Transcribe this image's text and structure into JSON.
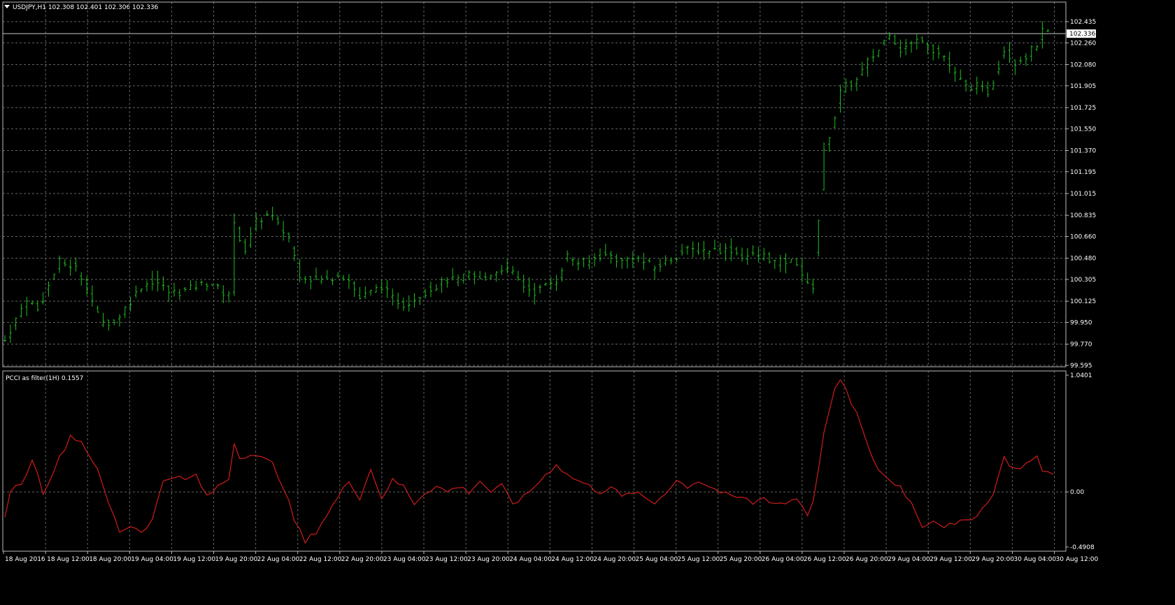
{
  "window": {
    "symbol_line": "USDJPY,H1  102.308 102.401 102.306 102.336",
    "indicator_line": "PCCI as filter(1H) 0.1557"
  },
  "colors": {
    "background": "#000000",
    "grid": "#5f6368",
    "price_bars": "#1fbf1f",
    "indicator_line": "#d01c1c",
    "text": "#ffffff"
  },
  "chart_data": [
    {
      "type": "ohlc",
      "title": "USDJPY,H1",
      "y_ticks": [
        "102.435",
        "102.260",
        "102.080",
        "101.905",
        "101.725",
        "101.550",
        "101.370",
        "101.195",
        "101.015",
        "100.835",
        "100.660",
        "100.480",
        "100.305",
        "100.125",
        "99.950",
        "99.770",
        "99.595"
      ],
      "ylim": [
        99.595,
        102.435
      ],
      "current_price": "102.336",
      "close_path": [
        [
          0,
          99.8
        ],
        [
          8,
          100.15
        ],
        [
          12,
          100.05
        ],
        [
          15,
          100.2
        ],
        [
          20,
          100.45
        ],
        [
          26,
          100.4
        ],
        [
          30,
          100.25
        ],
        [
          35,
          99.95
        ],
        [
          40,
          99.95
        ],
        [
          45,
          100.1
        ],
        [
          50,
          100.25
        ],
        [
          55,
          100.3
        ],
        [
          60,
          100.2
        ],
        [
          65,
          100.2
        ],
        [
          70,
          100.25
        ],
        [
          75,
          100.28
        ],
        [
          80,
          100.2
        ],
        [
          83,
          100.2
        ],
        [
          84,
          100.75
        ],
        [
          88,
          100.55
        ],
        [
          92,
          100.78
        ],
        [
          97,
          100.85
        ],
        [
          100,
          100.75
        ],
        [
          104,
          100.65
        ],
        [
          108,
          100.35
        ],
        [
          113,
          100.3
        ],
        [
          118,
          100.3
        ],
        [
          122,
          100.35
        ],
        [
          126,
          100.3
        ],
        [
          130,
          100.15
        ],
        [
          134,
          100.2
        ],
        [
          138,
          100.25
        ],
        [
          142,
          100.15
        ],
        [
          146,
          100.1
        ],
        [
          150,
          100.15
        ],
        [
          154,
          100.2
        ],
        [
          158,
          100.25
        ],
        [
          162,
          100.3
        ],
        [
          166,
          100.3
        ],
        [
          170,
          100.35
        ],
        [
          174,
          100.3
        ],
        [
          178,
          100.35
        ],
        [
          182,
          100.4
        ],
        [
          186,
          100.35
        ],
        [
          190,
          100.25
        ],
        [
          194,
          100.2
        ],
        [
          198,
          100.25
        ],
        [
          202,
          100.3
        ],
        [
          206,
          100.5
        ],
        [
          210,
          100.45
        ],
        [
          214,
          100.45
        ],
        [
          218,
          100.5
        ],
        [
          222,
          100.5
        ],
        [
          226,
          100.45
        ],
        [
          230,
          100.5
        ],
        [
          234,
          100.45
        ],
        [
          238,
          100.4
        ],
        [
          242,
          100.45
        ],
        [
          246,
          100.5
        ],
        [
          250,
          100.55
        ],
        [
          254,
          100.55
        ],
        [
          258,
          100.55
        ],
        [
          262,
          100.55
        ],
        [
          266,
          100.55
        ],
        [
          270,
          100.5
        ],
        [
          274,
          100.5
        ],
        [
          278,
          100.5
        ],
        [
          282,
          100.45
        ],
        [
          286,
          100.45
        ],
        [
          290,
          100.45
        ],
        [
          294,
          100.25
        ],
        [
          296,
          100.25
        ],
        [
          298,
          100.8
        ],
        [
          300,
          101.35
        ],
        [
          304,
          101.65
        ],
        [
          306,
          101.85
        ],
        [
          308,
          101.9
        ],
        [
          312,
          101.95
        ],
        [
          316,
          102.1
        ],
        [
          320,
          102.2
        ],
        [
          324,
          102.35
        ],
        [
          328,
          102.2
        ],
        [
          332,
          102.25
        ],
        [
          336,
          102.3
        ],
        [
          340,
          102.2
        ],
        [
          344,
          102.15
        ],
        [
          348,
          102.0
        ],
        [
          352,
          101.9
        ],
        [
          356,
          101.9
        ],
        [
          360,
          101.85
        ],
        [
          362,
          101.95
        ],
        [
          366,
          102.2
        ],
        [
          370,
          102.1
        ],
        [
          374,
          102.15
        ],
        [
          378,
          102.25
        ],
        [
          380,
          102.35
        ],
        [
          382,
          102.34
        ]
      ],
      "x_tick_labels": [
        "18 Aug 2016",
        "18 Aug 12:00",
        "18 Aug 20:00",
        "19 Aug 04:00",
        "19 Aug 12:00",
        "19 Aug 20:00",
        "22 Aug 04:00",
        "22 Aug 12:00",
        "22 Aug 20:00",
        "23 Aug 04:00",
        "23 Aug 12:00",
        "23 Aug 20:00",
        "24 Aug 04:00",
        "24 Aug 12:00",
        "24 Aug 20:00",
        "25 Aug 04:00",
        "25 Aug 12:00",
        "25 Aug 20:00",
        "26 Aug 04:00",
        "26 Aug 12:00",
        "26 Aug 20:00",
        "29 Aug 04:00",
        "29 Aug 12:00",
        "29 Aug 20:00",
        "30 Aug 04:00",
        "30 Aug 12:00"
      ]
    },
    {
      "type": "line",
      "title": "PCCI as filter(1H)",
      "current_value": "0.1557",
      "y_ticks": [
        "1.0401",
        "0.00",
        "-0.4908"
      ],
      "ylim": [
        -0.4908,
        1.0401
      ],
      "path": [
        [
          0,
          -0.25
        ],
        [
          3,
          0.1
        ],
        [
          6,
          0.05
        ],
        [
          10,
          0.3
        ],
        [
          14,
          0.0
        ],
        [
          18,
          0.2
        ],
        [
          24,
          0.5
        ],
        [
          28,
          0.45
        ],
        [
          33,
          0.25
        ],
        [
          38,
          -0.1
        ],
        [
          42,
          -0.35
        ],
        [
          46,
          -0.3
        ],
        [
          50,
          -0.35
        ],
        [
          54,
          -0.25
        ],
        [
          58,
          0.1
        ],
        [
          62,
          0.15
        ],
        [
          66,
          0.1
        ],
        [
          70,
          0.15
        ],
        [
          74,
          -0.05
        ],
        [
          78,
          0.05
        ],
        [
          82,
          0.12
        ],
        [
          84,
          0.45
        ],
        [
          86,
          0.3
        ],
        [
          90,
          0.35
        ],
        [
          94,
          0.3
        ],
        [
          98,
          0.25
        ],
        [
          102,
          0.05
        ],
        [
          106,
          -0.25
        ],
        [
          110,
          -0.45
        ],
        [
          114,
          -0.35
        ],
        [
          118,
          -0.2
        ],
        [
          122,
          -0.05
        ],
        [
          126,
          0.1
        ],
        [
          130,
          -0.05
        ],
        [
          134,
          0.2
        ],
        [
          138,
          -0.05
        ],
        [
          142,
          0.1
        ],
        [
          146,
          0.05
        ],
        [
          150,
          -0.1
        ],
        [
          154,
          0.0
        ],
        [
          158,
          0.05
        ],
        [
          162,
          0.0
        ],
        [
          166,
          0.05
        ],
        [
          170,
          0.0
        ],
        [
          174,
          0.1
        ],
        [
          178,
          0.0
        ],
        [
          182,
          0.05
        ],
        [
          186,
          -0.1
        ],
        [
          190,
          -0.05
        ],
        [
          194,
          0.05
        ],
        [
          198,
          0.15
        ],
        [
          202,
          0.25
        ],
        [
          206,
          0.15
        ],
        [
          210,
          0.1
        ],
        [
          214,
          0.05
        ],
        [
          218,
          0.0
        ],
        [
          222,
          0.05
        ],
        [
          226,
          -0.05
        ],
        [
          230,
          0.0
        ],
        [
          234,
          -0.05
        ],
        [
          238,
          -0.1
        ],
        [
          242,
          0.0
        ],
        [
          246,
          0.1
        ],
        [
          250,
          0.05
        ],
        [
          254,
          0.1
        ],
        [
          258,
          0.05
        ],
        [
          262,
          0.0
        ],
        [
          266,
          -0.05
        ],
        [
          270,
          -0.05
        ],
        [
          274,
          -0.1
        ],
        [
          278,
          -0.05
        ],
        [
          282,
          -0.1
        ],
        [
          286,
          -0.1
        ],
        [
          290,
          -0.05
        ],
        [
          294,
          -0.2
        ],
        [
          297,
          0.0
        ],
        [
          300,
          0.55
        ],
        [
          304,
          0.9
        ],
        [
          306,
          1.0
        ],
        [
          308,
          0.9
        ],
        [
          312,
          0.7
        ],
        [
          316,
          0.4
        ],
        [
          320,
          0.2
        ],
        [
          324,
          0.1
        ],
        [
          328,
          0.05
        ],
        [
          332,
          -0.1
        ],
        [
          336,
          -0.3
        ],
        [
          340,
          -0.25
        ],
        [
          344,
          -0.3
        ],
        [
          348,
          -0.3
        ],
        [
          352,
          -0.25
        ],
        [
          356,
          -0.2
        ],
        [
          360,
          -0.1
        ],
        [
          362,
          0.0
        ],
        [
          366,
          0.3
        ],
        [
          370,
          0.2
        ],
        [
          374,
          0.25
        ],
        [
          378,
          0.3
        ],
        [
          380,
          0.2
        ],
        [
          384,
          0.15
        ]
      ]
    }
  ]
}
